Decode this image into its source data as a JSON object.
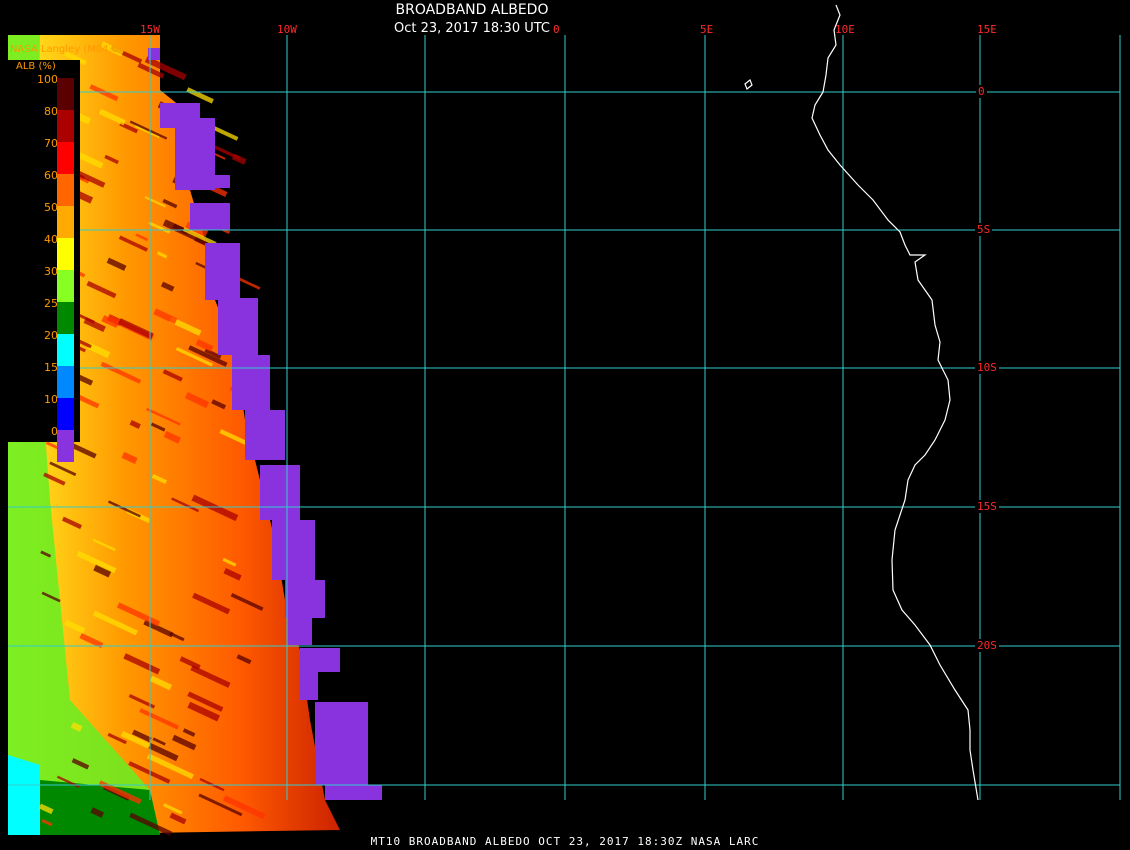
{
  "header": {
    "title": "BROADBAND ALBEDO",
    "datetime": "Oct 23, 2017 18:30 UTC",
    "producer": "NASA Langley (M04.0)"
  },
  "footer": {
    "caption": "MT10  BROADBAND ALBEDO   OCT 23, 2017 18:30Z   NASA LARC"
  },
  "legend": {
    "title": "ALB (%)",
    "labels": [
      "100",
      "80",
      "70",
      "60",
      "50",
      "40",
      "30",
      "25",
      "20",
      "15",
      "10",
      "0"
    ],
    "colors": [
      "#5a0000",
      "#aa0000",
      "#ff0000",
      "#ff6600",
      "#ffaa00",
      "#ffff00",
      "#88ff22",
      "#008800",
      "#00ffff",
      "#0088ff",
      "#0000ff",
      "#8833dd"
    ]
  },
  "grid": {
    "color": "#33cccc",
    "lon_labels": [
      "15W",
      "10W",
      "0",
      "5E",
      "10E",
      "15E"
    ],
    "lat_labels": [
      "0",
      "5S",
      "10S",
      "15S",
      "20S"
    ]
  },
  "colors": {
    "background": "#000000",
    "coastline": "#ffffff",
    "label": "#ff2a2a",
    "legend_text": "#ff9900"
  }
}
